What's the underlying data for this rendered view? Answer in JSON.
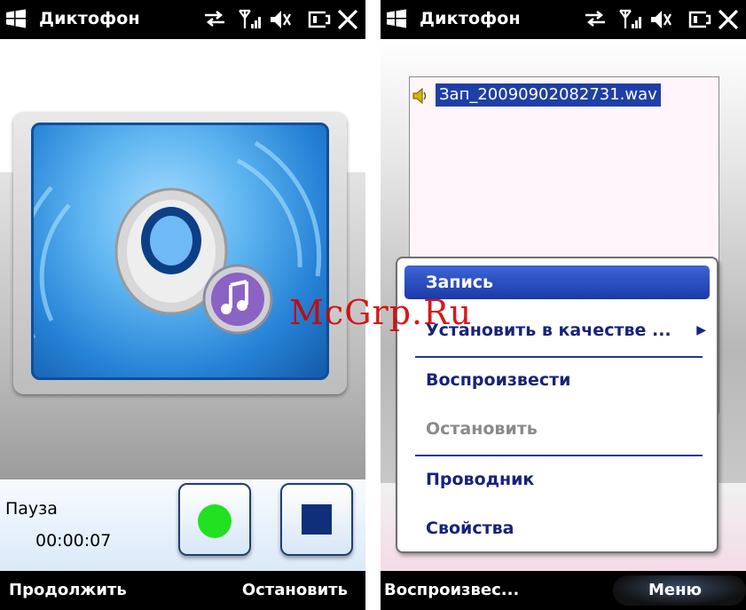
{
  "left": {
    "title": "Диктофон",
    "status_label": "Пауза",
    "timer": "00:00:07",
    "softkeys": {
      "left": "Продолжить",
      "right": "Остановить"
    },
    "record_button_icon": "record-dot-icon",
    "stop_button_icon": "stop-square-icon"
  },
  "right": {
    "title": "Диктофон",
    "file": {
      "name": "Зап_20090902082731.wav",
      "icon": "speaker-file-icon"
    },
    "menu": {
      "items": [
        {
          "label": "Запись",
          "state": "selected"
        },
        {
          "label": "Установить в качестве ...",
          "state": "submenu"
        },
        {
          "label": "Воспроизвести",
          "state": "enabled"
        },
        {
          "label": "Остановить",
          "state": "disabled"
        },
        {
          "label": "Проводник",
          "state": "enabled"
        },
        {
          "label": "Свойства",
          "state": "enabled"
        }
      ]
    },
    "softkeys": {
      "left": "Воспроизвес...",
      "right": "Меню"
    }
  },
  "status_icons": [
    "sync-icon",
    "signal-icon",
    "volume-icon",
    "battery-icon",
    "close-icon"
  ],
  "watermark": "McGrp.Ru",
  "colors": {
    "titlebar": "#000000",
    "menu_text": "#16237a",
    "selection": "#1f3fa8",
    "record": "#21e021",
    "stop": "#0f2f7a",
    "watermark": "#d40000"
  }
}
